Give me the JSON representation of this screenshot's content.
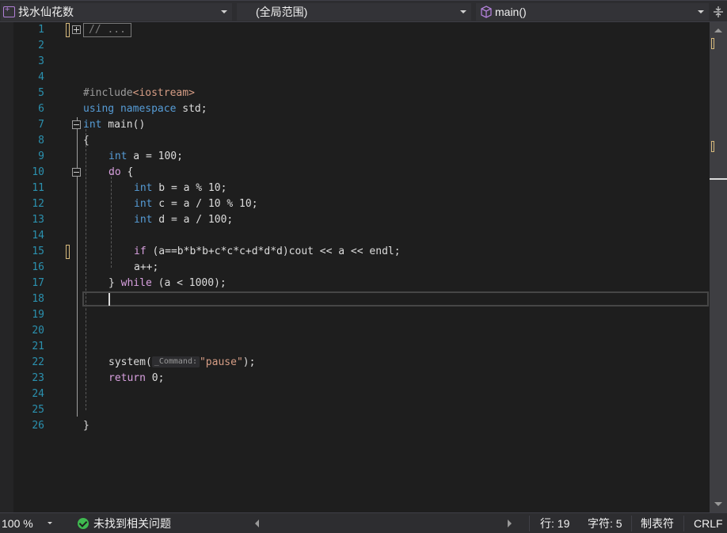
{
  "navbar": {
    "project": "找水仙花数",
    "scope": "(全局范围)",
    "function": "main()"
  },
  "editor": {
    "line_numbers": [
      "1",
      "2",
      "3",
      "4",
      "5",
      "6",
      "7",
      "8",
      "9",
      "10",
      "11",
      "12",
      "13",
      "14",
      "15",
      "16",
      "17",
      "18",
      "19",
      "20",
      "21",
      "22",
      "23",
      "24",
      "25",
      "26"
    ],
    "collapsed_region": "// ...",
    "line5_hash": "#include",
    "line5_header": "<iostream>",
    "line6_using": "using",
    "line6_namespace": "namespace",
    "line6_rest": " std;",
    "line7_int": "int",
    "line7_rest": " main()",
    "line8": "{",
    "line9_int": "int",
    "line9_rest": " a = 100;",
    "line10_do": "do",
    "line10_rest": " {",
    "line11_int": "int",
    "line11_rest": " b = a % 10;",
    "line12_int": "int",
    "line12_rest": " c = a / 10 % 10;",
    "line13_int": "int",
    "line13_rest": " d = a / 100;",
    "line15_if": "if",
    "line15_rest": " (a==b*b*b+c*c*c+d*d*d)cout << a << endl;",
    "line16": "a++;",
    "line17_brace": "} ",
    "line17_while": "while",
    "line17_rest": " (a < 1000);",
    "line22_fn": "system(",
    "line22_hint": "_Command:",
    "line22_str": "\"pause\"",
    "line22_end": ");",
    "line23_return": "return",
    "line23_rest": " 0;",
    "line26": "}"
  },
  "status": {
    "zoom": "100 %",
    "issues": "未找到相关问题",
    "line": "行: 19",
    "char": "字符: 5",
    "tabs": "制表符",
    "eol": "CRLF"
  },
  "colors": {
    "keyword": "#569cd6",
    "control": "#d8a0df",
    "string": "#d69d85",
    "line_number": "#2b91af",
    "background": "#1e1e1e"
  }
}
